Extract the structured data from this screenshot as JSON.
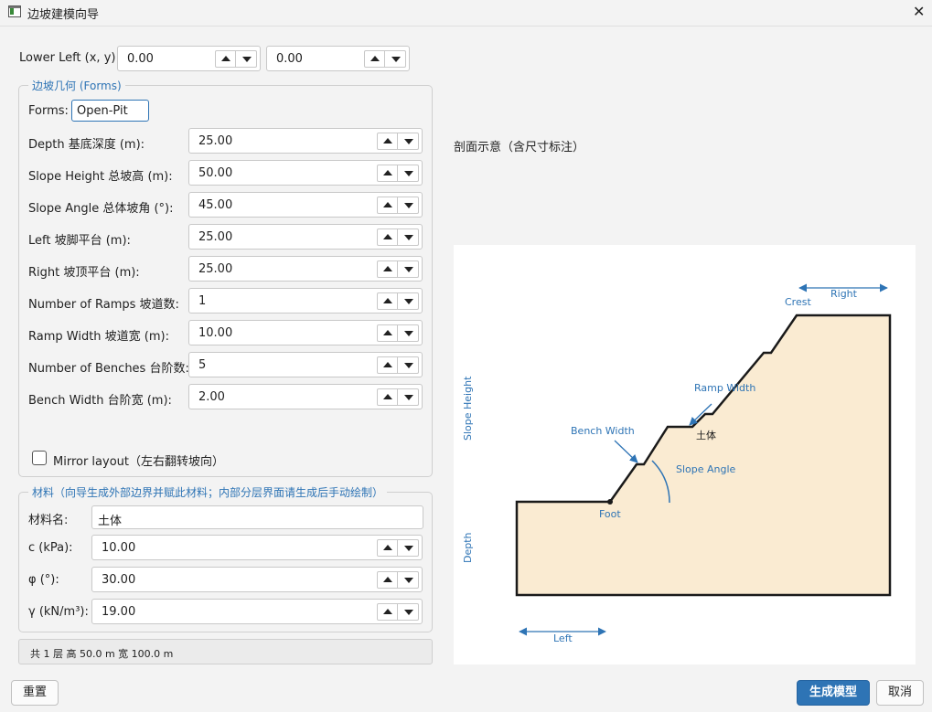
{
  "window": {
    "title": "边坡建模向导"
  },
  "lower_left": {
    "label": "Lower Left (x, y):",
    "x": "0.00",
    "y": "0.00"
  },
  "geometry": {
    "group_title": "边坡几何 (Forms)",
    "forms_label": "Forms:",
    "forms_value": "Open-Pit",
    "fields": [
      {
        "label": "Depth 基底深度 (m):",
        "value": "25.00"
      },
      {
        "label": "Slope Height 总坡高 (m):",
        "value": "50.00"
      },
      {
        "label": "Slope Angle 总体坡角 (°):",
        "value": "45.00"
      },
      {
        "label": "Left 坡脚平台 (m):",
        "value": "25.00"
      },
      {
        "label": "Right 坡顶平台 (m):",
        "value": "25.00"
      },
      {
        "label": "Number of Ramps 坡道数:",
        "value": "1"
      },
      {
        "label": "Ramp Width 坡道宽 (m):",
        "value": "10.00"
      },
      {
        "label": "Number of Benches 台阶数:",
        "value": "5"
      },
      {
        "label": "Bench Width 台阶宽 (m):",
        "value": "2.00"
      }
    ],
    "mirror_label": "Mirror layout（左右翻转坡向）",
    "mirror_checked": false
  },
  "material": {
    "group_title": "材料（向导生成外部边界并赋此材料；内部分层界面请生成后手动绘制）",
    "name_label": "材料名:",
    "name_value": "土体",
    "fields": [
      {
        "label": "c (kPa):",
        "value": "10.00"
      },
      {
        "label": "φ (°):",
        "value": "30.00"
      },
      {
        "label": "γ (kN/m³):",
        "value": "19.00"
      }
    ]
  },
  "status_text": "共 1 层  高 50.0 m  宽 100.0 m",
  "preview": {
    "title": "剖面示意（含尺寸标注）",
    "labels": {
      "right": "Right",
      "crest": "Crest",
      "ramp_width": "Ramp Width",
      "material": "土体",
      "bench_width": "Bench Width",
      "slope_angle": "Slope Angle",
      "foot": "Foot",
      "slope_height": "Slope Height",
      "depth": "Depth",
      "left": "Left"
    },
    "colors": {
      "fill": "#faebd2",
      "accent": "#2e74b5",
      "outline": "#1a1a1a"
    }
  },
  "buttons": {
    "reset": "重置",
    "generate": "生成模型",
    "cancel": "取消"
  }
}
